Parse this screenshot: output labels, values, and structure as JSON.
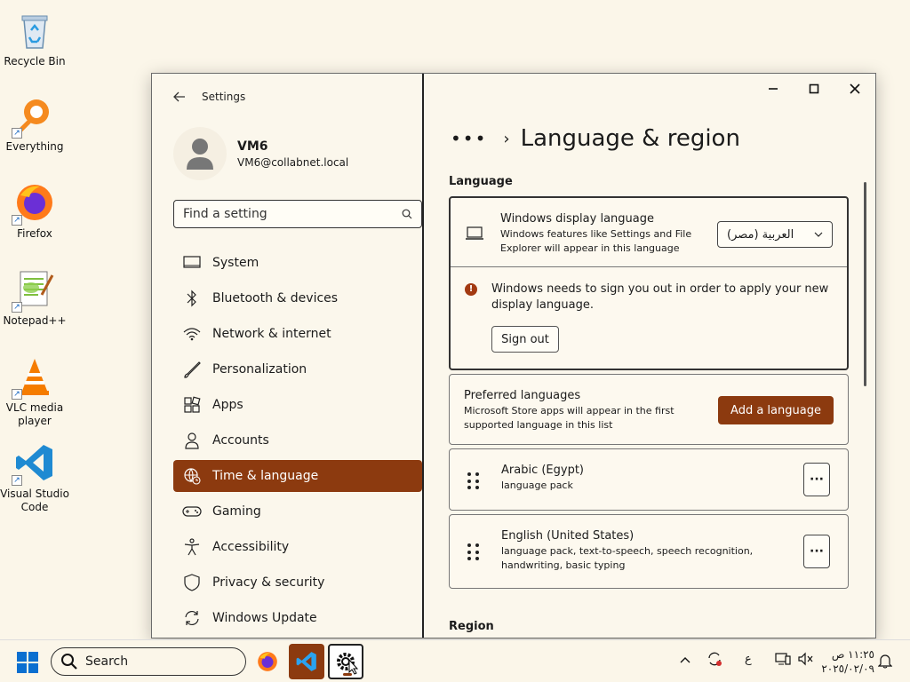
{
  "desktop": {
    "icons": [
      {
        "label": "Recycle Bin",
        "icon": "recycle-bin-icon"
      },
      {
        "label": "Everything",
        "icon": "everything-search-icon"
      },
      {
        "label": "Firefox",
        "icon": "firefox-icon"
      },
      {
        "label": "Notepad++",
        "icon": "notepadpp-icon"
      },
      {
        "label": "VLC media player",
        "icon": "vlc-icon"
      },
      {
        "label": "Visual Studio Code",
        "icon": "vscode-icon"
      }
    ]
  },
  "window": {
    "app_title": "Settings",
    "controls": {
      "minimize": "—",
      "maximize": "▢",
      "close": "✕"
    }
  },
  "profile": {
    "name": "VM6",
    "email": "VM6@collabnet.local"
  },
  "search": {
    "placeholder": "Find a setting"
  },
  "nav": {
    "items": [
      {
        "label": "System",
        "icon": "monitor-icon"
      },
      {
        "label": "Bluetooth & devices",
        "icon": "bluetooth-icon"
      },
      {
        "label": "Network & internet",
        "icon": "wifi-icon"
      },
      {
        "label": "Personalization",
        "icon": "brush-icon"
      },
      {
        "label": "Apps",
        "icon": "apps-icon"
      },
      {
        "label": "Accounts",
        "icon": "person-icon"
      },
      {
        "label": "Time & language",
        "icon": "globe-clock-icon",
        "active": true
      },
      {
        "label": "Gaming",
        "icon": "gamepad-icon"
      },
      {
        "label": "Accessibility",
        "icon": "accessibility-icon"
      },
      {
        "label": "Privacy & security",
        "icon": "shield-icon"
      },
      {
        "label": "Windows Update",
        "icon": "update-icon"
      }
    ]
  },
  "content": {
    "breadcrumb_more": "•••",
    "breadcrumb_sep": "›",
    "page_title": "Language & region",
    "language_heading": "Language",
    "display_language": {
      "title": "Windows display language",
      "subtitle": "Windows features like Settings and File Explorer will appear in this language",
      "selected": "العربية (مصر)"
    },
    "signout_notice": {
      "message": "Windows needs to sign you out in order to apply your new display language.",
      "button": "Sign out"
    },
    "preferred": {
      "title": "Preferred languages",
      "subtitle": "Microsoft Store apps will appear in the first supported language in this list",
      "button": "Add a language"
    },
    "languages": [
      {
        "name": "Arabic (Egypt)",
        "features": "language pack"
      },
      {
        "name": "English (United States)",
        "features": "language pack, text-to-speech, speech recognition, handwriting, basic typing"
      }
    ],
    "more_label": "···",
    "region_heading": "Region"
  },
  "taskbar": {
    "search_label": "Search",
    "tray_lang": "ع",
    "time": "١١:٢٥ ص",
    "date": "٢٠٢٥/٠٢/٠٩"
  },
  "colors": {
    "accent": "#8c3a0f",
    "background": "#fbf6e9"
  }
}
